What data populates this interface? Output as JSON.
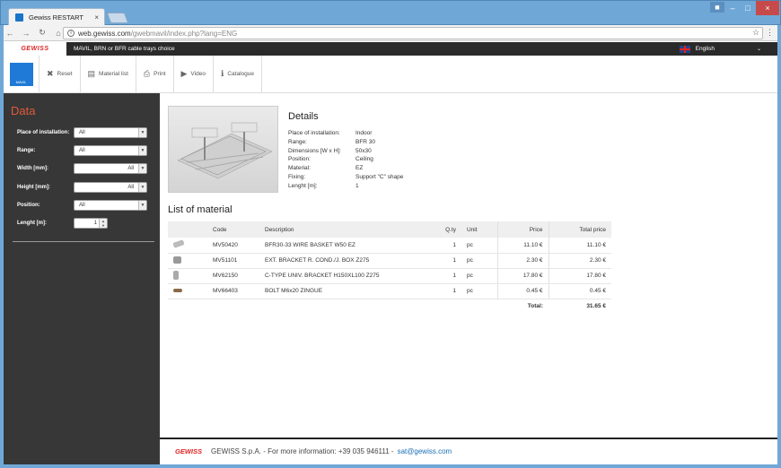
{
  "browser": {
    "tab_title": "Gewiss RESTART",
    "url_host": "web.gewiss.com",
    "url_path": "/gwebmavil/index.php?lang=ENG"
  },
  "site": {
    "logo": "GEWISS",
    "subtitle": "MAVIL, BRN or BFR cable trays choice",
    "language": "English",
    "brand_box": "MAVIL"
  },
  "toolbar": {
    "items": [
      {
        "label": "Reset",
        "icon": "cross-icon"
      },
      {
        "label": "Material list",
        "icon": "list-icon"
      },
      {
        "label": "Print",
        "icon": "print-icon"
      },
      {
        "label": "Video",
        "icon": "video-icon"
      },
      {
        "label": "Catalogue",
        "icon": "info-icon"
      }
    ]
  },
  "sidebar": {
    "title": "Data",
    "fields": [
      {
        "label": "Place of installation:",
        "value": "All"
      },
      {
        "label": "Range:",
        "value": "All"
      },
      {
        "label": "Width [mm]:",
        "value": "All"
      },
      {
        "label": "Height [mm]:",
        "value": "All"
      },
      {
        "label": "Position:",
        "value": "All"
      }
    ],
    "length": {
      "label": "Lenght [m]:",
      "value": "1"
    }
  },
  "details": {
    "title": "Details",
    "rows": [
      {
        "k": "Place of installation:",
        "v": "Indoor"
      },
      {
        "k": "Range:",
        "v": "BFR 30"
      },
      {
        "k": "Dimensions [W x H]:",
        "v": "50x30"
      },
      {
        "k": "Position:",
        "v": "Ceiling"
      },
      {
        "k": "Material:",
        "v": "EZ"
      },
      {
        "k": "Fixing:",
        "v": "Support \"C\" shape"
      },
      {
        "k": "Lenght [m]:",
        "v": "1"
      }
    ]
  },
  "materials": {
    "title": "List of material",
    "headers": [
      "Code",
      "Description",
      "Q.ty",
      "Unit",
      "Price",
      "Total price"
    ],
    "rows": [
      {
        "code": "MV50420",
        "desc": "BFR30-33 WIRE BASKET W50 EZ",
        "qty": "1",
        "unit": "pc",
        "price": "11.10 €",
        "total": "11.10 €"
      },
      {
        "code": "MV51101",
        "desc": "EXT. BRACKET R. COND./J. BOX Z275",
        "qty": "1",
        "unit": "pc",
        "price": "2.30 €",
        "total": "2.30 €"
      },
      {
        "code": "MV62150",
        "desc": "C-TYPE UNIV. BRACKET H150XL100 Z275",
        "qty": "1",
        "unit": "pc",
        "price": "17.80 €",
        "total": "17.80 €"
      },
      {
        "code": "MV66403",
        "desc": "BOLT M6x20 ZINGUE",
        "qty": "1",
        "unit": "pc",
        "price": "0.45 €",
        "total": "0.45 €"
      }
    ],
    "total_label": "Total:",
    "total_value": "31.65 €"
  },
  "footer": {
    "logo": "GEWISS",
    "text": "GEWISS S.p.A. - For more information: +39 035 946111 -",
    "email": "sat@gewiss.com"
  }
}
